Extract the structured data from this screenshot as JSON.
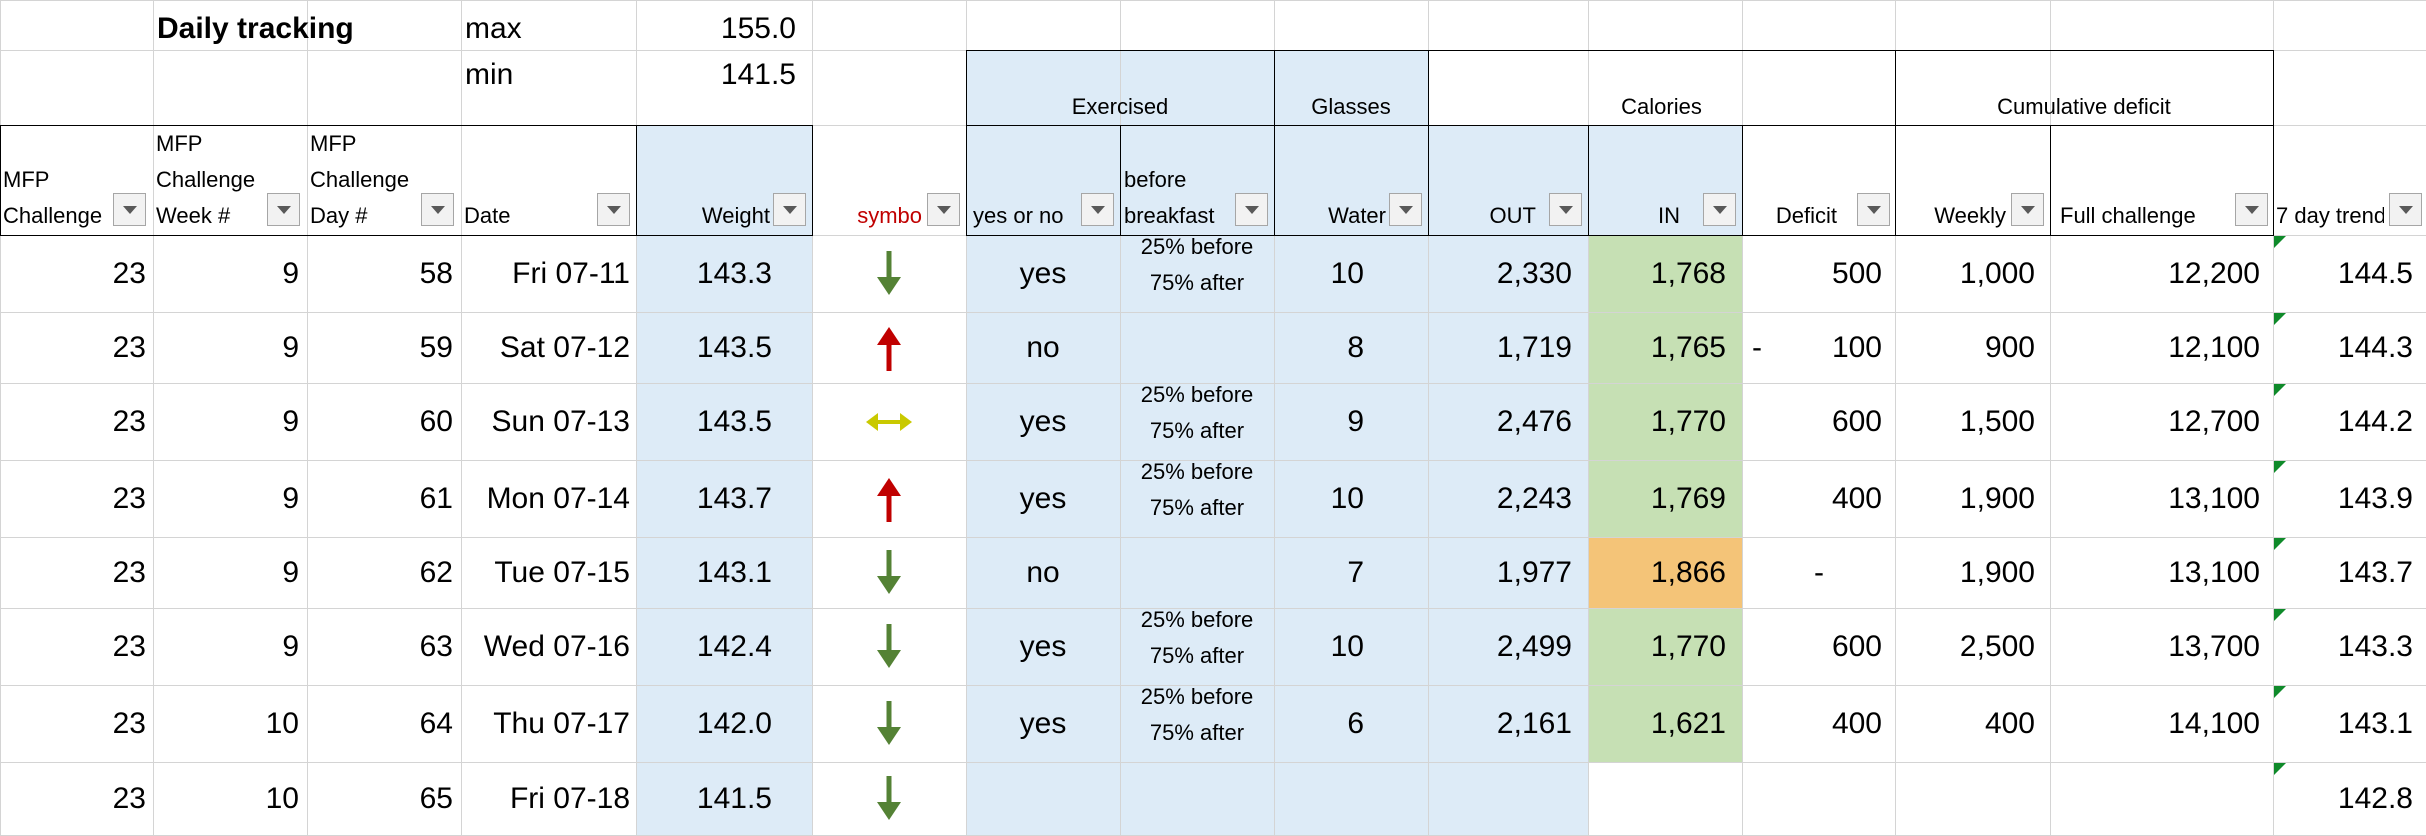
{
  "top": {
    "daily_tracking": "Daily tracking",
    "max_label": "max",
    "max_value": "155.0",
    "min_label": "min",
    "min_value": "141.5"
  },
  "group_headers": {
    "exercised": "Exercised",
    "glasses": "Glasses",
    "calories": "Calories",
    "cumulative_deficit": "Cumulative deficit"
  },
  "columns": {
    "challenge": [
      "MFP",
      "Challenge"
    ],
    "week": [
      "MFP",
      "Challenge",
      "Week #"
    ],
    "day": [
      "MFP",
      "Challenge",
      "Day #"
    ],
    "date": "Date",
    "weight": "Weight",
    "symbol": "symbo",
    "yes_or_no": "yes or no",
    "before_breakfast": [
      "before",
      "breakfast"
    ],
    "water": "Water",
    "out": "OUT",
    "in": "IN",
    "deficit": "Deficit",
    "weekly": "Weekly",
    "full_challenge": "Full challenge",
    "trend": "7 day trend"
  },
  "colors": {
    "blue_fill": "#ddebf7",
    "green_fill": "#c6e0b4",
    "orange_fill": "#f4c478",
    "down_arrow": "#548235",
    "up_arrow": "#c00000",
    "side_arrow": "#c9c900",
    "symbol_header": "#c00000"
  },
  "rows": [
    {
      "challenge": "23",
      "week": "9",
      "day": "58",
      "date": "Fri 07-11",
      "weight": "143.3",
      "symbol": "down-arrow-icon",
      "exercised": "yes",
      "note": [
        "25% before",
        "75% after"
      ],
      "water": "10",
      "out": "2,330",
      "in": "1,768",
      "in_fill": "green",
      "deficit_prefix": "",
      "deficit": "500",
      "weekly": "1,000",
      "full": "12,200",
      "trend": "144.5"
    },
    {
      "challenge": "23",
      "week": "9",
      "day": "59",
      "date": "Sat 07-12",
      "weight": "143.5",
      "symbol": "up-arrow-icon",
      "exercised": "no",
      "note": [
        "",
        ""
      ],
      "water": "8",
      "out": "1,719",
      "in": "1,765",
      "in_fill": "green",
      "deficit_prefix": "-",
      "deficit": "100",
      "weekly": "900",
      "full": "12,100",
      "trend": "144.3"
    },
    {
      "challenge": "23",
      "week": "9",
      "day": "60",
      "date": "Sun 07-13",
      "weight": "143.5",
      "symbol": "side-arrow-icon",
      "exercised": "yes",
      "note": [
        "25% before",
        "75% after"
      ],
      "water": "9",
      "out": "2,476",
      "in": "1,770",
      "in_fill": "green",
      "deficit_prefix": "",
      "deficit": "600",
      "weekly": "1,500",
      "full": "12,700",
      "trend": "144.2"
    },
    {
      "challenge": "23",
      "week": "9",
      "day": "61",
      "date": "Mon 07-14",
      "weight": "143.7",
      "symbol": "up-arrow-icon",
      "exercised": "yes",
      "note": [
        "25% before",
        "75% after"
      ],
      "water": "10",
      "out": "2,243",
      "in": "1,769",
      "in_fill": "green",
      "deficit_prefix": "",
      "deficit": "400",
      "weekly": "1,900",
      "full": "13,100",
      "trend": "143.9"
    },
    {
      "challenge": "23",
      "week": "9",
      "day": "62",
      "date": "Tue 07-15",
      "weight": "143.1",
      "symbol": "down-arrow-icon",
      "exercised": "no",
      "note": [
        "",
        ""
      ],
      "water": "7",
      "out": "1,977",
      "in": "1,866",
      "in_fill": "orange",
      "deficit_prefix": "",
      "deficit": "-",
      "weekly": "1,900",
      "full": "13,100",
      "trend": "143.7"
    },
    {
      "challenge": "23",
      "week": "9",
      "day": "63",
      "date": "Wed 07-16",
      "weight": "142.4",
      "symbol": "down-arrow-icon",
      "exercised": "yes",
      "note": [
        "25% before",
        "75% after"
      ],
      "water": "10",
      "out": "2,499",
      "in": "1,770",
      "in_fill": "green",
      "deficit_prefix": "",
      "deficit": "600",
      "weekly": "2,500",
      "full": "13,700",
      "trend": "143.3"
    },
    {
      "challenge": "23",
      "week": "10",
      "day": "64",
      "date": "Thu 07-17",
      "weight": "142.0",
      "symbol": "down-arrow-icon",
      "exercised": "yes",
      "note": [
        "25% before",
        "75% after"
      ],
      "water": "6",
      "out": "2,161",
      "in": "1,621",
      "in_fill": "green",
      "deficit_prefix": "",
      "deficit": "400",
      "weekly": "400",
      "full": "14,100",
      "trend": "143.1"
    },
    {
      "challenge": "23",
      "week": "10",
      "day": "65",
      "date": "Fri 07-18",
      "weight": "141.5",
      "symbol": "down-arrow-icon",
      "exercised": "",
      "note": [
        "",
        ""
      ],
      "water": "",
      "out": "",
      "in": "",
      "in_fill": "none",
      "deficit_prefix": "",
      "deficit": "",
      "weekly": "",
      "full": "",
      "trend": "142.8"
    }
  ]
}
